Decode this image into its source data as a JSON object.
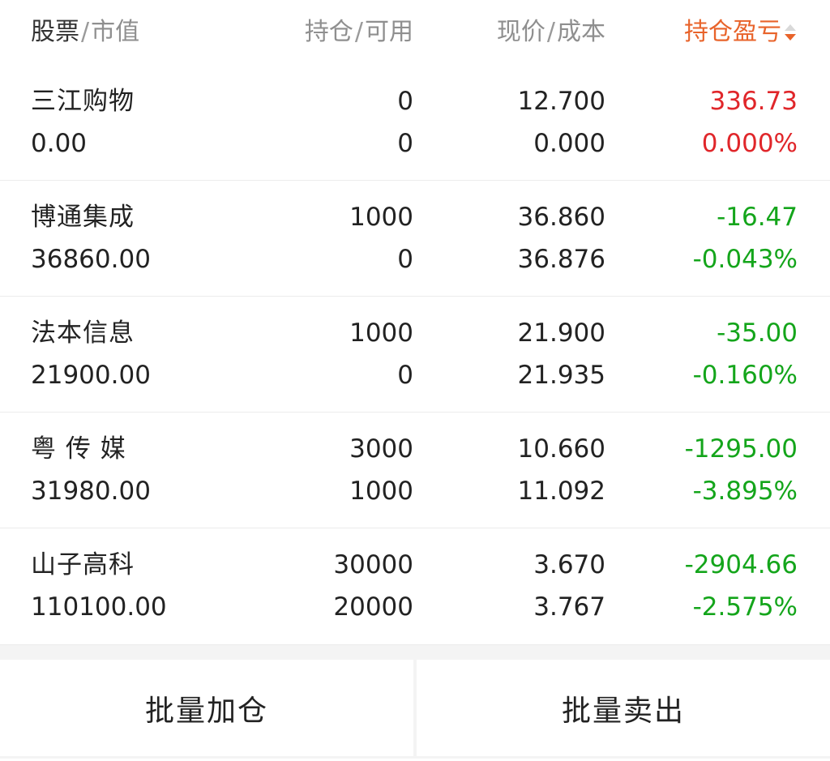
{
  "header": {
    "stock_label": "股票",
    "sep1": "/",
    "market_value_label": "市值",
    "position_label": "持仓",
    "sep2": "/",
    "available_label": "可用",
    "price_label": "现价",
    "sep3": "/",
    "cost_label": "成本",
    "pl_label": "持仓盈亏"
  },
  "colors": {
    "up": "#e0262a",
    "down": "#14a51b",
    "accent": "#e8632a"
  },
  "rows": [
    {
      "name": "三江购物",
      "market_value": "0.00",
      "position": "0",
      "available": "0",
      "price": "12.700",
      "cost": "0.000",
      "pl": "336.73",
      "pl_pct": "0.000%",
      "trend": "up"
    },
    {
      "name": "博通集成",
      "market_value": "36860.00",
      "position": "1000",
      "available": "0",
      "price": "36.860",
      "cost": "36.876",
      "pl": "-16.47",
      "pl_pct": "-0.043%",
      "trend": "down"
    },
    {
      "name": "法本信息",
      "market_value": "21900.00",
      "position": "1000",
      "available": "0",
      "price": "21.900",
      "cost": "21.935",
      "pl": "-35.00",
      "pl_pct": "-0.160%",
      "trend": "down"
    },
    {
      "name": "粤 传 媒",
      "market_value": "31980.00",
      "position": "3000",
      "available": "1000",
      "price": "10.660",
      "cost": "11.092",
      "pl": "-1295.00",
      "pl_pct": "-3.895%",
      "trend": "down"
    },
    {
      "name": "山子高科",
      "market_value": "110100.00",
      "position": "30000",
      "available": "20000",
      "price": "3.670",
      "cost": "3.767",
      "pl": "-2904.66",
      "pl_pct": "-2.575%",
      "trend": "down"
    }
  ],
  "footer": {
    "batch_add_label": "批量加仓",
    "batch_sell_label": "批量卖出"
  }
}
